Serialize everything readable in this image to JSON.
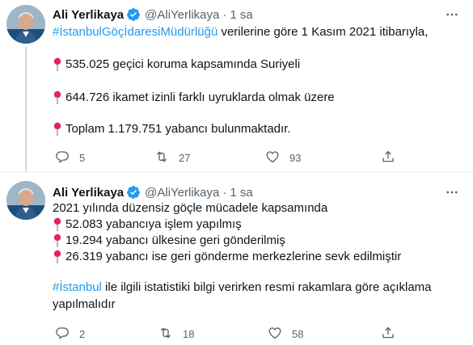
{
  "tweets": [
    {
      "author_name": "Ali Yerlikaya",
      "handle": "@AliYerlikaya",
      "separator": "·",
      "time": "1 sa",
      "line1_hashtag": "#İstanbulGöçİdaresiMüdürlüğü",
      "line1_text": " verilerine göre 1 Kasım 2021 itibarıyla,",
      "item1": "535.025 geçici koruma kapsamında Suriyeli",
      "item2": "644.726 ikamet izinli farklı uyruklarda olmak üzere",
      "item3": "Toplam 1.179.751 yabancı bulunmaktadır.",
      "replies": "5",
      "retweets": "27",
      "likes": "93"
    },
    {
      "author_name": "Ali Yerlikaya",
      "handle": "@AliYerlikaya",
      "separator": "·",
      "time": "1 sa",
      "intro": "2021 yılında düzensiz göçle mücadele kapsamında",
      "item1": "52.083 yabancıya işlem yapılmış",
      "item2": "19.294 yabancı ülkesine geri gönderilmiş",
      "item3": "26.319 yabancı ise geri gönderme merkezlerine sevk edilmiştir",
      "line2_hashtag": "#İstanbul",
      "line2_text": " ile ilgili istatistiki bilgi verirken resmi rakamlara göre açıklama",
      "line3_text": "yapılmalıdır",
      "replies": "2",
      "retweets": "18",
      "likes": "58"
    }
  ],
  "icons": {
    "verified": "verified-badge-icon",
    "pin": "round-pushpin-icon",
    "reply": "reply-icon",
    "retweet": "retweet-icon",
    "like": "heart-icon",
    "share": "share-icon",
    "more": "more-icon"
  },
  "colors": {
    "accent": "#1d9bf0",
    "text": "#0f1419",
    "secondary": "#536471",
    "pin": "#e0245e"
  }
}
